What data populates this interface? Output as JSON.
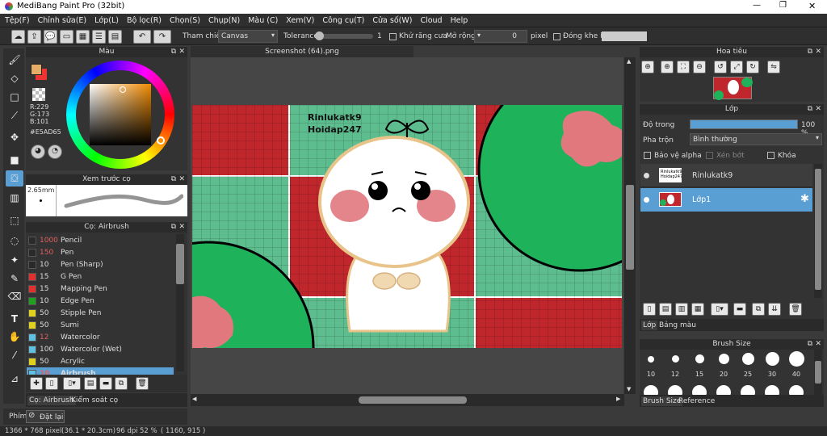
{
  "window": {
    "title": "MediBang Paint Pro (32bit)",
    "min": "—",
    "max": "❐",
    "close": "✕"
  },
  "menu": [
    "Tệp(F)",
    "Chỉnh sửa(E)",
    "Lớp(L)",
    "Bộ lọc(R)",
    "Chọn(S)",
    "Chụp(N)",
    "Màu (C)",
    "Xem(V)",
    "Công cụ(T)",
    "Cửa số(W)",
    "Cloud",
    "Help"
  ],
  "toolbar": {
    "reference_label": "Tham chiếu",
    "reference_value": "Canvas",
    "tolerance_label": "Tolerance",
    "tolerance_value": "1",
    "antialias_label": "Khử răng cưa",
    "expand_label": "Mở rộng",
    "expand_value": "0",
    "expand_unit": "pixel",
    "close_gap_label": "Đóng khe hở"
  },
  "color_panel": {
    "title": "Màu",
    "r": "R:229",
    "g": "G:173",
    "b": "B:101",
    "hex": "#E5AD65",
    "primary": "#e5ad65",
    "secondary": "#ffffff"
  },
  "brush_preview": {
    "title": "Xem trước cọ",
    "size": "2.65mm"
  },
  "brush_panel": {
    "title": "Cọ: Airbrush",
    "items": [
      {
        "size": "1000",
        "name": "Pencil",
        "color": "#2a2a2a",
        "size_color": "#e06060"
      },
      {
        "size": "150",
        "name": "Pen",
        "color": "#2a2a2a",
        "size_color": "#e06060"
      },
      {
        "size": "10",
        "name": "Pen (Sharp)",
        "color": "#2a2a2a",
        "size_color": "#dddddd"
      },
      {
        "size": "15",
        "name": "G Pen",
        "color": "#e03030",
        "size_color": "#dddddd"
      },
      {
        "size": "15",
        "name": "Mapping Pen",
        "color": "#e03030",
        "size_color": "#dddddd"
      },
      {
        "size": "10",
        "name": "Edge Pen",
        "color": "#20a020",
        "size_color": "#dddddd"
      },
      {
        "size": "50",
        "name": "Stipple Pen",
        "color": "#e0d020",
        "size_color": "#dddddd"
      },
      {
        "size": "50",
        "name": "Sumi",
        "color": "#e0d020",
        "size_color": "#dddddd"
      },
      {
        "size": "12",
        "name": "Watercolor",
        "color": "#60c0e0",
        "size_color": "#e06060"
      },
      {
        "size": "100",
        "name": "Watercolor (Wet)",
        "color": "#60c0e0",
        "size_color": "#dddddd"
      },
      {
        "size": "50",
        "name": "Acrylic",
        "color": "#e0d020",
        "size_color": "#dddddd"
      },
      {
        "size": "10",
        "name": "Airbrush",
        "color": "#60c0e0",
        "size_color": "#e06060"
      }
    ],
    "tab1": "Cọ: Airbrush",
    "tab2": "Kiểm soát cọ"
  },
  "bottom_left": {
    "key_label": "Phím",
    "reset_label": "Đặt lại"
  },
  "canvas": {
    "tab_title": "Screenshot (64).png",
    "text_line1": "Rinlukatk9",
    "text_line2": "Hoidap247"
  },
  "navigator": {
    "title": "Hoa tiêu"
  },
  "layer_panel": {
    "title": "Lớp",
    "opacity_label": "Độ trong",
    "opacity_value": "100 %",
    "opacity": 1.0,
    "blend_label": "Pha trộn",
    "blend_value": "Bình thường",
    "protect_alpha": "Bảo vệ alpha",
    "clipping": "Xén bớt",
    "lock": "Khóa",
    "layers": [
      {
        "name": "Rinlukatk9",
        "thumb_text": "Rinlukatk9 Hoidap247"
      },
      {
        "name": "Lớp1"
      }
    ],
    "tab1": "Lớp",
    "tab2": "Bảng màu"
  },
  "brush_size_panel": {
    "title": "Brush Size",
    "sizes": [
      "10",
      "12",
      "15",
      "20",
      "25",
      "30",
      "40"
    ],
    "tab1": "Brush Size",
    "tab2": "Reference"
  },
  "status_bar": {
    "dimensions": "1366 * 768 pixel",
    "physical": "(36.1 * 20.3cm)",
    "dpi": "96 dpi",
    "zoom": "52 %",
    "coords": "( 1160, 915 )"
  },
  "colors": {
    "canvas_red": "#c0272d",
    "canvas_green": "#5dbd8e",
    "leaf_green": "#1eb35a",
    "leaf_pink": "#e0787d",
    "accent_blue": "#5a9fd4"
  }
}
